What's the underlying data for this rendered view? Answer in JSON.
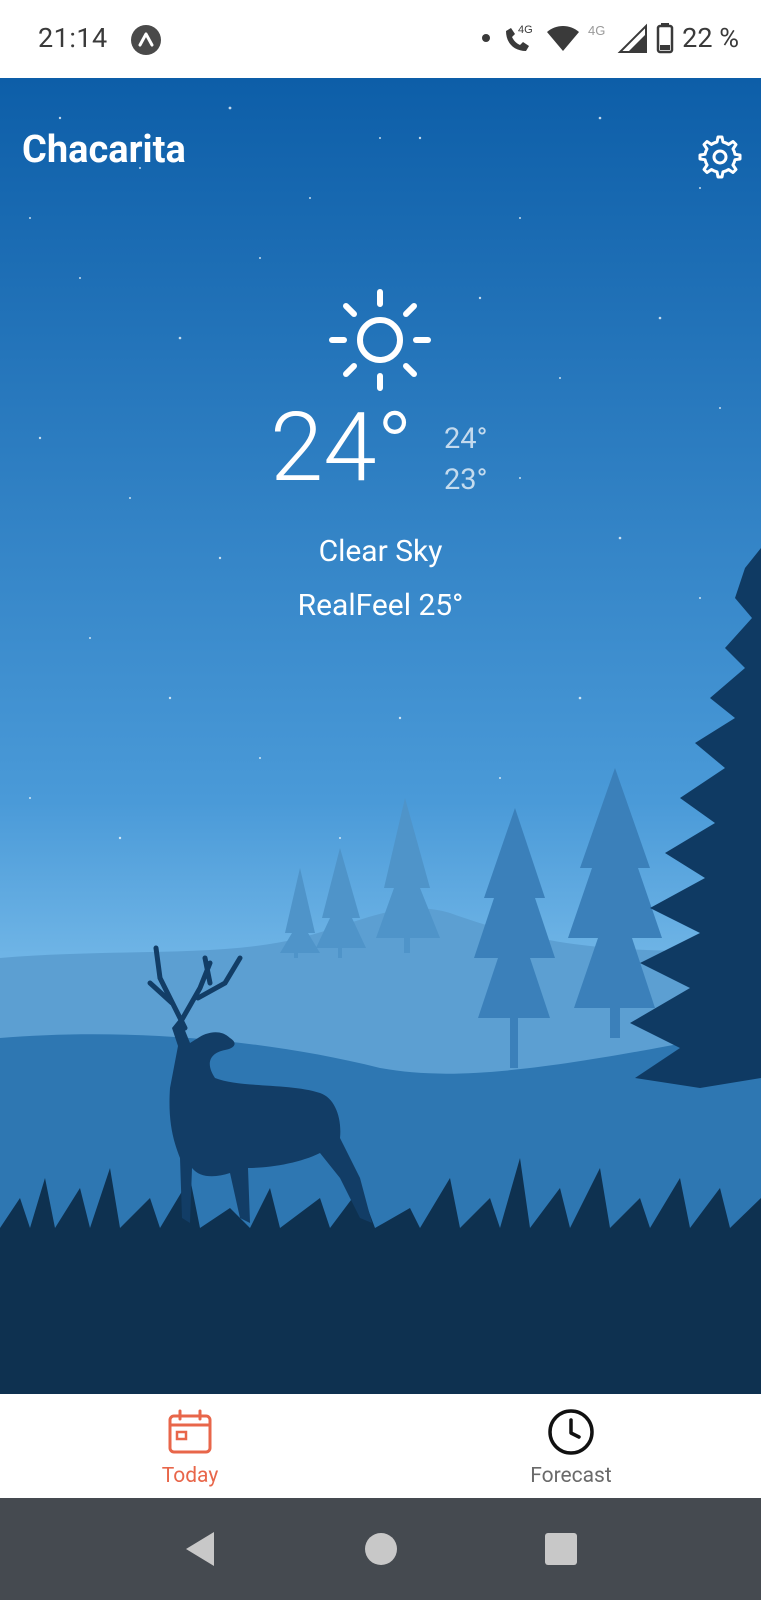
{
  "status_bar": {
    "time": "21:14",
    "battery_text": "22 %",
    "network_label_1": "4G",
    "network_label_2": "4G",
    "icons": [
      "app-notification-icon",
      "dot-icon",
      "volte-call-icon",
      "wifi-icon",
      "cell-signal-icon",
      "battery-icon"
    ]
  },
  "header": {
    "city": "Chacarita",
    "settings_icon": "gear-icon"
  },
  "current": {
    "condition_icon": "sun-icon",
    "temperature": "24°",
    "high": "24°",
    "low": "23°",
    "condition": "Clear Sky",
    "realfeel": "RealFeel 25°"
  },
  "bottom_nav": {
    "items": [
      {
        "label": "Today",
        "icon": "calendar-icon",
        "active": true
      },
      {
        "label": "Forecast",
        "icon": "clock-icon",
        "active": false
      }
    ],
    "active_color": "#e8664a"
  },
  "system_nav": {
    "buttons": [
      "back-icon",
      "home-icon",
      "recents-icon"
    ]
  },
  "colors": {
    "sky_top": "#0d5ea8",
    "sky_bottom": "#7fc0ec",
    "ground": "#0e3150",
    "system_nav_bg": "#454a50"
  }
}
